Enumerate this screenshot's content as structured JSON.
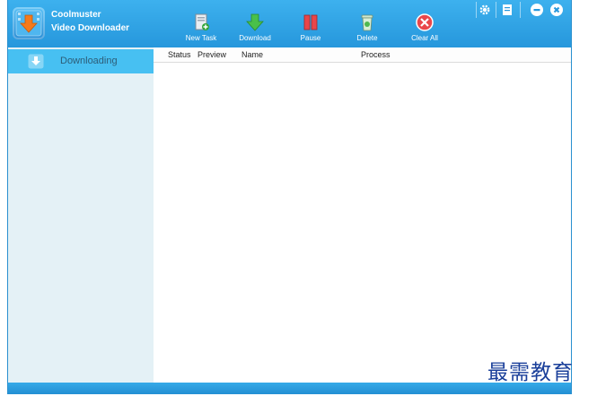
{
  "app": {
    "name_line1": "Coolmuster",
    "name_line2": "Video Downloader",
    "logo_icon": "video-download-logo"
  },
  "toolbar": {
    "buttons": [
      {
        "label": "New Task",
        "icon": "new-task-icon"
      },
      {
        "label": "Download",
        "icon": "download-arrow-icon"
      },
      {
        "label": "Pause",
        "icon": "pause-icon"
      },
      {
        "label": "Delete",
        "icon": "trash-icon"
      },
      {
        "label": "Clear All",
        "icon": "clear-all-icon"
      }
    ]
  },
  "window_controls": [
    "settings-gear-icon",
    "register-icon",
    "minimize-icon",
    "close-icon"
  ],
  "sidebar": {
    "items": [
      {
        "label": "Downloading",
        "icon": "downloading-icon",
        "selected": true
      }
    ]
  },
  "table": {
    "columns": [
      "Status",
      "Preview",
      "Name",
      "Process"
    ]
  },
  "watermark": "最需教育",
  "colors": {
    "titlebar": "#2a9fe2",
    "sidebar_bg": "#e4f1f6",
    "sidebar_selected": "#47c0f2"
  }
}
